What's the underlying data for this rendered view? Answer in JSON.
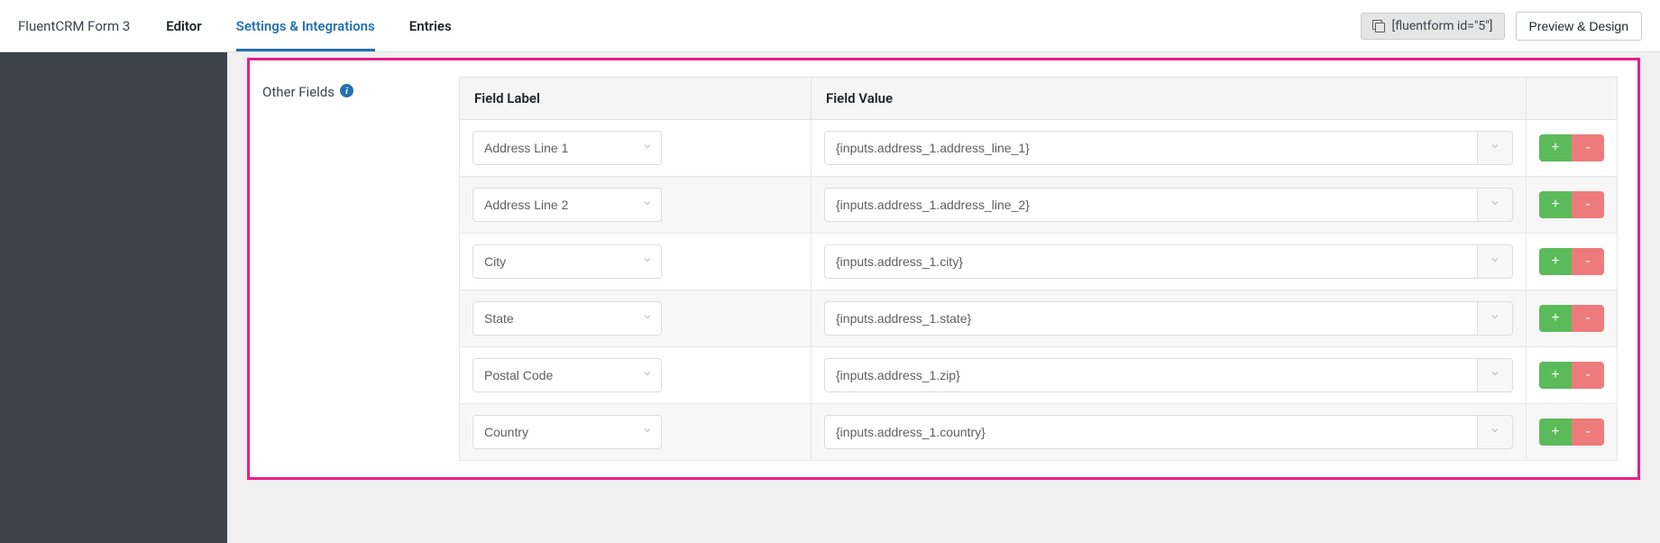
{
  "header": {
    "form_title": "FluentCRM Form 3",
    "tabs": {
      "editor": "Editor",
      "settings": "Settings & Integrations",
      "entries": "Entries"
    },
    "shortcode": "[fluentform id=\"5\"]",
    "preview_button": "Preview & Design"
  },
  "section": {
    "label": "Other Fields"
  },
  "table": {
    "headers": {
      "label": "Field Label",
      "value": "Field Value"
    },
    "rows": [
      {
        "label": "Address Line 1",
        "value": "{inputs.address_1.address_line_1}"
      },
      {
        "label": "Address Line 2",
        "value": "{inputs.address_1.address_line_2}"
      },
      {
        "label": "City",
        "value": "{inputs.address_1.city}"
      },
      {
        "label": "State",
        "value": "{inputs.address_1.state}"
      },
      {
        "label": "Postal Code",
        "value": "{inputs.address_1.zip}"
      },
      {
        "label": "Country",
        "value": "{inputs.address_1.country}"
      }
    ]
  },
  "actions": {
    "add": "+",
    "remove": "-"
  }
}
